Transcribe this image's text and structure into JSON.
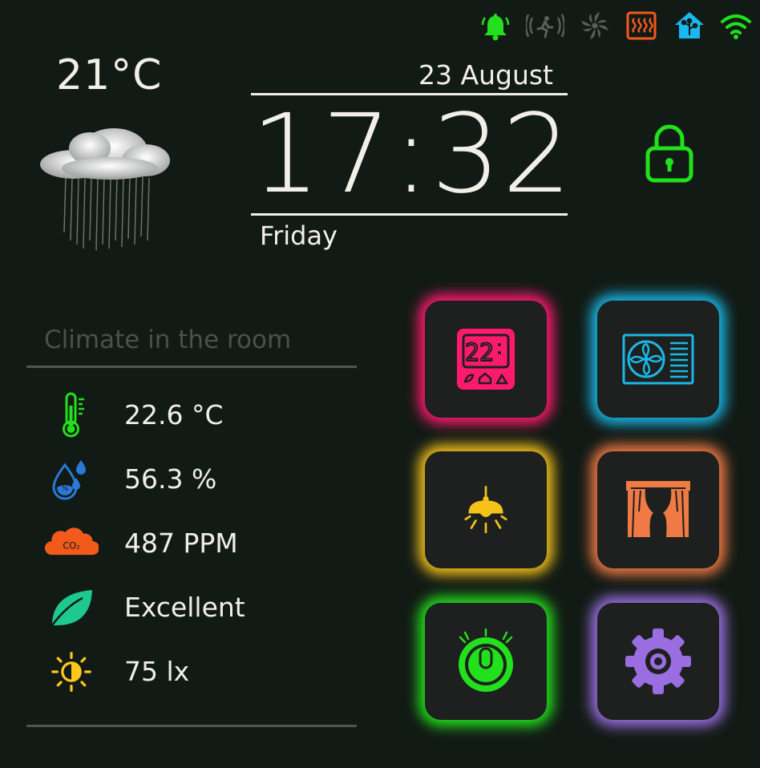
{
  "status_bar": {
    "icons": [
      "bell-icon",
      "motion-sensor-icon",
      "fan-icon",
      "heater-icon",
      "smart-home-icon",
      "wifi-icon"
    ],
    "colors": {
      "bell": "#22e01c",
      "motion": "#5a5f5c",
      "fan": "#5a5f5c",
      "heater": "#f25a1c",
      "home": "#1ab8f0",
      "wifi": "#22e01c"
    }
  },
  "weather": {
    "temperature": "21°C",
    "icon": "rain-cloud-icon"
  },
  "clock": {
    "date": "23 August",
    "time": "17:32",
    "weekday": "Friday"
  },
  "lock": {
    "icon": "padlock-icon",
    "color": "#22e01c"
  },
  "climate": {
    "title": "Climate in the room",
    "readings": [
      {
        "icon": "thermometer-icon",
        "value": "22.6 °C",
        "color": "#22e01c"
      },
      {
        "icon": "humidity-icon",
        "value": "56.3 %",
        "color": "#2a78d8"
      },
      {
        "icon": "co2-icon",
        "value": "487 PPM",
        "color": "#f25a1c"
      },
      {
        "icon": "leaf-icon",
        "value": "Excellent",
        "color": "#1ec98f"
      },
      {
        "icon": "brightness-icon",
        "value": "75 lx",
        "color": "#ffc81a"
      }
    ]
  },
  "tiles": [
    {
      "name": "thermostat",
      "icon": "thermostat-icon",
      "display": "22",
      "glow": "#ff1a6e"
    },
    {
      "name": "air-conditioner",
      "icon": "air-conditioner-icon",
      "glow": "#1ab8e8"
    },
    {
      "name": "ceiling-lamp",
      "icon": "ceiling-lamp-icon",
      "glow": "#f5c21a"
    },
    {
      "name": "curtains",
      "icon": "curtains-icon",
      "glow": "#f07a45"
    },
    {
      "name": "robot-vacuum",
      "icon": "robot-vacuum-icon",
      "glow": "#22e01c"
    },
    {
      "name": "settings",
      "icon": "gear-icon",
      "glow": "#9a6ee0"
    }
  ]
}
